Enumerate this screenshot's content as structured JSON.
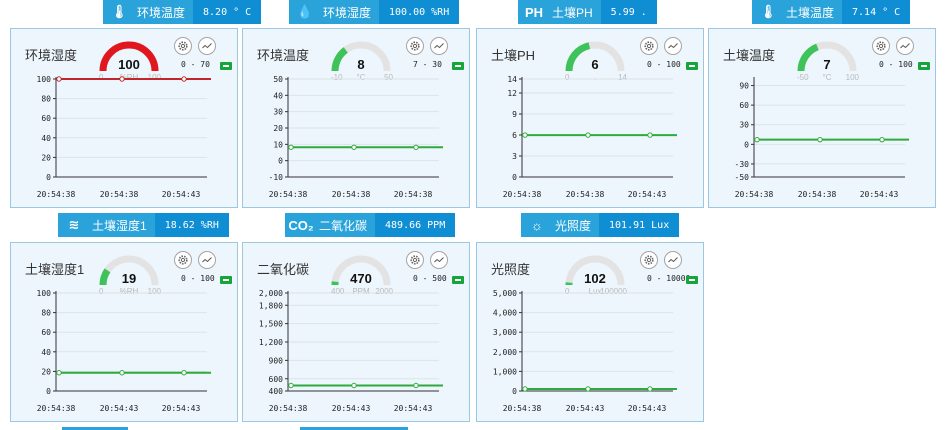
{
  "badges": [
    {
      "icon": "thermometer-icon",
      "glyph": "🌡",
      "label": "环境温度",
      "value": "8.20 ° C"
    },
    {
      "icon": "droplet-icon",
      "glyph": "💧",
      "label": "环境湿度",
      "value": "100.00 %RH"
    },
    {
      "icon": "ph-icon",
      "glyph": "PH",
      "label": "土壤PH",
      "value": "5.99 ."
    },
    {
      "icon": "soil-thermometer-icon",
      "glyph": "🌡",
      "label": "土壤温度",
      "value": "7.14 ° C"
    },
    {
      "icon": "soil-moisture-icon",
      "glyph": "≋",
      "label": "土壤湿度1",
      "value": "18.62 %RH"
    },
    {
      "icon": "co2-icon",
      "glyph": "CO₂",
      "label": "二氧化碳",
      "value": "489.66 PPM"
    },
    {
      "icon": "sun-icon",
      "glyph": "☼",
      "label": "光照度",
      "value": "101.91 Lux"
    }
  ],
  "colors": {
    "accent": "#2aa3da",
    "accent_dark": "#0f8ed3",
    "gauge_red": "#e0181e",
    "gauge_green": "#3ec35b",
    "line_red": "#c0262c",
    "line_green": "#2dab3c"
  },
  "cards": [
    {
      "title": "环境湿度",
      "gauge": {
        "value": "100",
        "min": "0",
        "unit": "%RH",
        "max": "100",
        "fraction": 1.0,
        "color": "red"
      },
      "range": "0 - 70",
      "chart_data": {
        "type": "line",
        "y_ticks": [
          "100",
          "80",
          "60",
          "40",
          "20",
          "0"
        ],
        "ylim": [
          0,
          100
        ],
        "x_ticks": [
          "20:54:38",
          "20:54:38",
          "20:54:43"
        ],
        "values": [
          100,
          100,
          100
        ],
        "color": "red"
      }
    },
    {
      "title": "环境温度",
      "gauge": {
        "value": "8",
        "min": "-10",
        "unit": "°C",
        "max": "50",
        "fraction": 0.3,
        "color": "green"
      },
      "range": "7 - 30",
      "chart_data": {
        "type": "line",
        "y_ticks": [
          "50",
          "40",
          "30",
          "20",
          "10",
          "0",
          "-10"
        ],
        "ylim": [
          -10,
          50
        ],
        "x_ticks": [
          "20:54:38",
          "20:54:38",
          "20:54:38"
        ],
        "values": [
          8.2,
          8.2,
          8.2
        ],
        "color": "green"
      }
    },
    {
      "title": "土壤PH",
      "gauge": {
        "value": "6",
        "min": "0",
        "unit": ".",
        "max": "14",
        "fraction": 0.43,
        "color": "green"
      },
      "range": "0 - 100",
      "chart_data": {
        "type": "line",
        "y_ticks": [
          "14",
          "12",
          "9",
          "6",
          "3",
          "0"
        ],
        "ylim": [
          0,
          14
        ],
        "x_ticks": [
          "20:54:38",
          "20:54:38",
          "20:54:43"
        ],
        "values": [
          5.99,
          5.99,
          5.99
        ],
        "color": "green"
      }
    },
    {
      "title": "土壤温度",
      "gauge": {
        "value": "7",
        "min": "-50",
        "unit": "°C",
        "max": "100",
        "fraction": 0.38,
        "color": "green"
      },
      "range": "0 - 100",
      "chart_data": {
        "type": "line",
        "y_ticks": [
          "90",
          "60",
          "30",
          "0",
          "-30",
          "-50"
        ],
        "ylim": [
          -50,
          100
        ],
        "x_ticks": [
          "20:54:38",
          "20:54:38",
          "20:54:43"
        ],
        "values": [
          7.14,
          7.14,
          7.14
        ],
        "color": "green"
      }
    },
    {
      "title": "土壤湿度1",
      "gauge": {
        "value": "19",
        "min": "0",
        "unit": "%RH",
        "max": "100",
        "fraction": 0.19,
        "color": "green"
      },
      "range": "0 - 100",
      "chart_data": {
        "type": "line",
        "y_ticks": [
          "100",
          "80",
          "60",
          "40",
          "20",
          "0"
        ],
        "ylim": [
          0,
          100
        ],
        "x_ticks": [
          "20:54:38",
          "20:54:43",
          "20:54:43"
        ],
        "values": [
          18.62,
          18.62,
          18.62
        ],
        "color": "green"
      }
    },
    {
      "title": "二氧化碳",
      "gauge": {
        "value": "470",
        "min": "400",
        "unit": "PPM",
        "max": "2000",
        "fraction": 0.04,
        "color": "green"
      },
      "range": "0 - 500",
      "chart_data": {
        "type": "line",
        "y_ticks": [
          "2,000",
          "1,800",
          "1,500",
          "1,200",
          "900",
          "600",
          "400"
        ],
        "ylim": [
          400,
          2000
        ],
        "x_ticks": [
          "20:54:38",
          "20:54:43",
          "20:54:43"
        ],
        "values": [
          489.66,
          489.66,
          489.66
        ],
        "color": "green"
      }
    },
    {
      "title": "光照度",
      "gauge": {
        "value": "102",
        "min": "0",
        "unit": "Lux",
        "max": "100000",
        "fraction": 0.001,
        "color": "green"
      },
      "range": "0 - 10000",
      "chart_data": {
        "type": "line",
        "y_ticks": [
          "5,000",
          "4,000",
          "3,000",
          "2,000",
          "1,000",
          "0"
        ],
        "ylim": [
          0,
          5000
        ],
        "x_ticks": [
          "20:54:38",
          "20:54:43",
          "20:54:43"
        ],
        "values": [
          101.91,
          101.91,
          101.91
        ],
        "color": "green"
      }
    }
  ]
}
